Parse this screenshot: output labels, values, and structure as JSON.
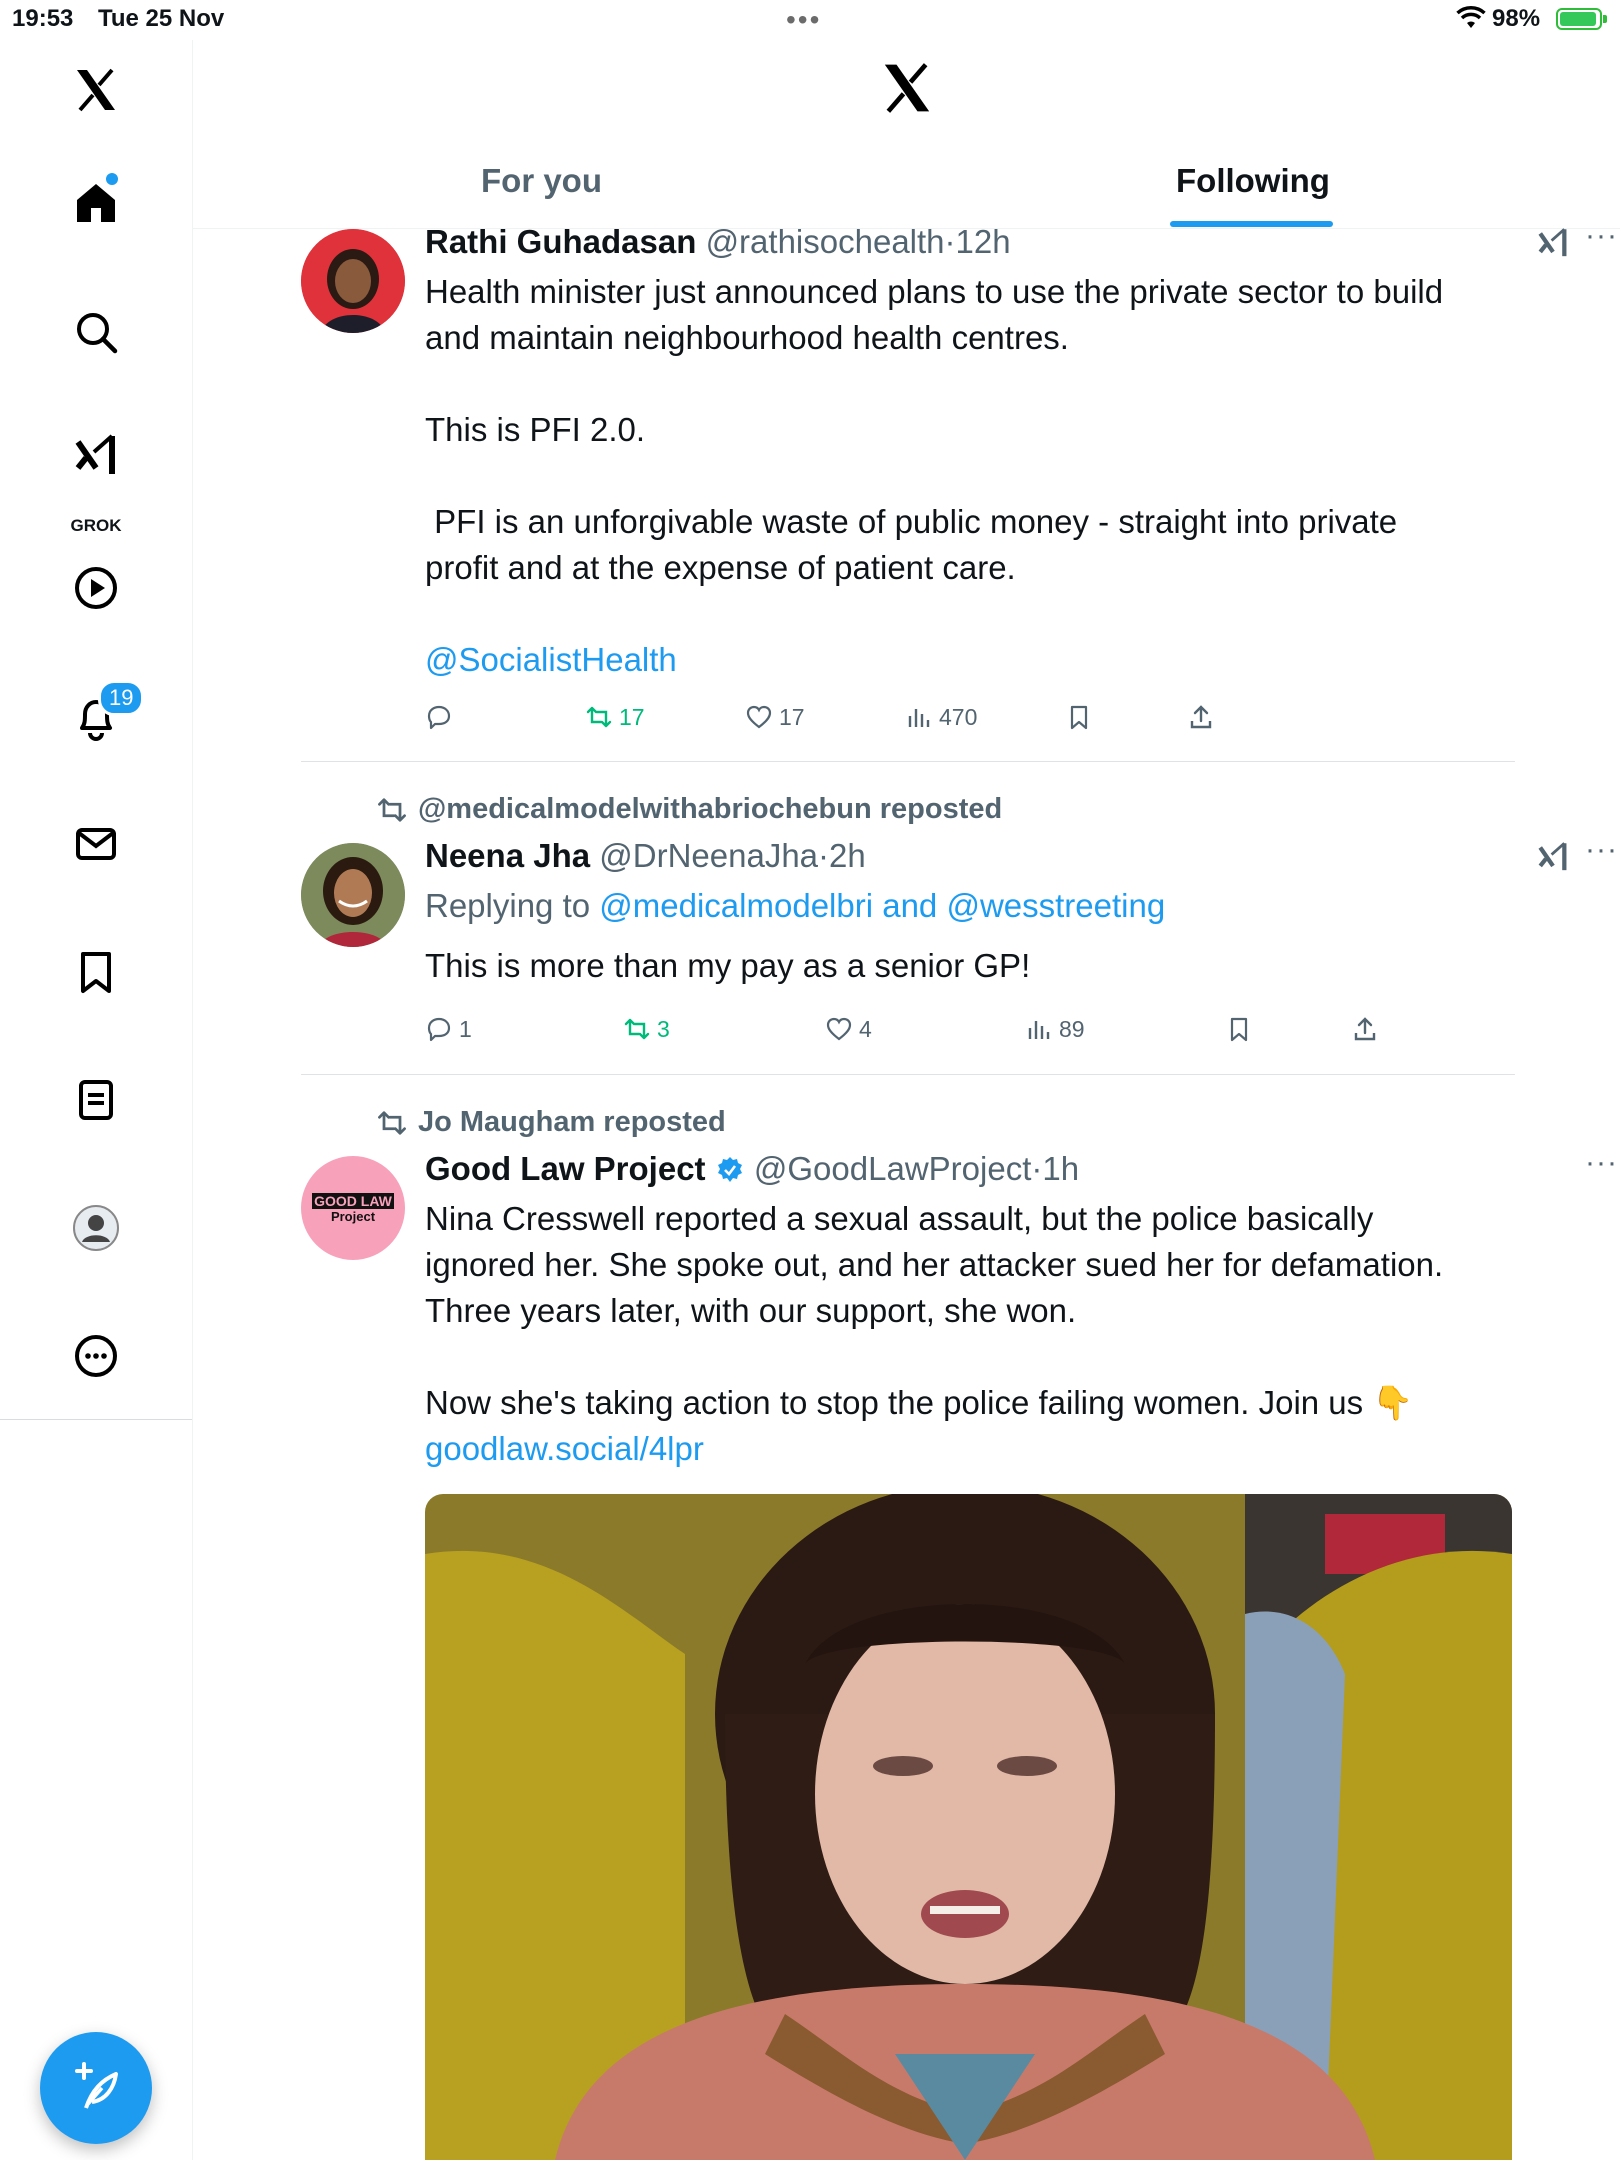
{
  "status_bar": {
    "time": "19:53",
    "date": "Tue 25 Nov",
    "battery": "98%"
  },
  "sidebar": {
    "grok_label": "GROK",
    "notifications_badge": "19"
  },
  "header": {
    "tabs": [
      {
        "label": "For you"
      },
      {
        "label": "Following"
      }
    ],
    "active_tab": "Following"
  },
  "tweets": [
    {
      "name": "Rathi Guhadasan",
      "handle": "@rathisochealth",
      "sep": "·",
      "time": "12h",
      "text": "Health minister just announced plans to use the private sector to build\nand maintain neighbourhood health centres.\n\nThis is PFI 2.0.\n\n PFI is an unforgivable waste of public money - straight into private\nprofit and at the expense of patient care.\n\n",
      "mention": "@SocialistHealth",
      "actions": {
        "replies": "",
        "reposts": "17",
        "likes": "17",
        "views": "470"
      }
    },
    {
      "repost_by": "@medicalmodelwithabriochebun reposted",
      "name": "Neena Jha",
      "handle": "@DrNeenaJha",
      "sep": "·",
      "time": "2h",
      "replying_prefix": "Replying to",
      "replying_to": "@medicalmodelbri and @wesstreeting",
      "text": "This is more than my pay as a senior GP!",
      "actions": {
        "replies": "1",
        "reposts": "3",
        "likes": "4",
        "views": "89"
      }
    },
    {
      "repost_by": "Jo Maugham reposted",
      "name": "Good Law Project",
      "handle": "@GoodLawProject",
      "sep": "·",
      "time": "1h",
      "avatar_text_1": "GOOD LAW",
      "avatar_text_2": "Project",
      "text": "Nina Cresswell reported a sexual assault, but the police basically\nignored her. She spoke out, and her attacker sued her for defamation.\nThree years later, with our support, she won.\n\nNow she's taking action to stop the police failing women. Join us 👇",
      "link": "goodlaw.social/4lpr"
    }
  ],
  "colors": {
    "accent": "#1d9bf0",
    "repost_green": "#00ba7c",
    "secondary_text": "#536471"
  }
}
